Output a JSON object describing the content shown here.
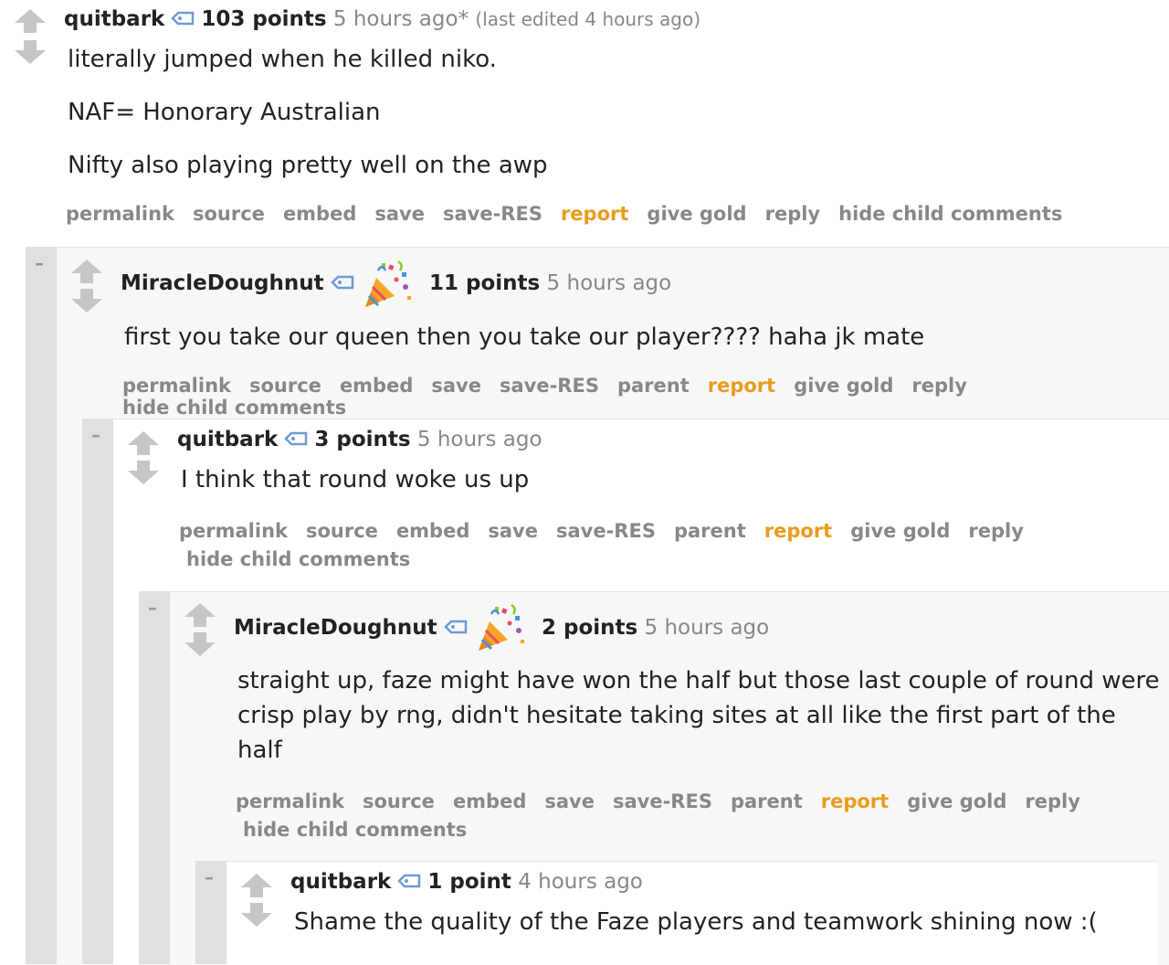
{
  "comments": [
    {
      "author": "quitbark",
      "score": "103 points",
      "time": "5 hours ago*",
      "edited": "(last edited 4 hours ago)",
      "body": [
        "literally jumped when he killed niko.",
        "NAF= Honorary Australian",
        "Nifty also playing pretty well on the awp"
      ],
      "buttons": [
        "permalink",
        "source",
        "embed",
        "save",
        "save-RES",
        "report",
        "give gold",
        "reply",
        "hide child comments"
      ]
    },
    {
      "collapse": "–",
      "author": "MiracleDoughnut",
      "score": "11 points",
      "time": "5 hours ago",
      "body": [
        "first you take our queen then you take our player???? haha jk mate"
      ],
      "buttons": [
        "permalink",
        "source",
        "embed",
        "save",
        "save-RES",
        "parent",
        "report",
        "give gold",
        "reply",
        "hide child comments"
      ]
    },
    {
      "collapse": "–",
      "author": "quitbark",
      "score": "3 points",
      "time": "5 hours ago",
      "body": [
        "I think that round woke us up"
      ],
      "buttons": [
        "permalink",
        "source",
        "embed",
        "save",
        "save-RES",
        "parent",
        "report",
        "give gold",
        "reply",
        "hide child comments"
      ]
    },
    {
      "collapse": "–",
      "author": "MiracleDoughnut",
      "score": "2 points",
      "time": "5 hours ago",
      "body": [
        "straight up, faze might have won the half but those last couple of round were crisp play by rng, didn't hesitate taking sites at all like the first part of the half"
      ],
      "buttons": [
        "permalink",
        "source",
        "embed",
        "save",
        "save-RES",
        "parent",
        "report",
        "give gold",
        "reply",
        "hide child comments"
      ]
    },
    {
      "collapse": "–",
      "author": "quitbark",
      "score": "1 point",
      "time": "4 hours ago",
      "body": [
        "Shame the quality of the Faze players and teamwork shining now :("
      ]
    }
  ],
  "colors": {
    "report": "#e89d1d",
    "muted": "#888888",
    "block_bg": "#f7f7f7"
  },
  "icons": {
    "upvote": "upvote-arrow-icon",
    "downvote": "downvote-arrow-icon",
    "user_tag": "user-tag-icon",
    "flair": "party-popper-icon"
  }
}
